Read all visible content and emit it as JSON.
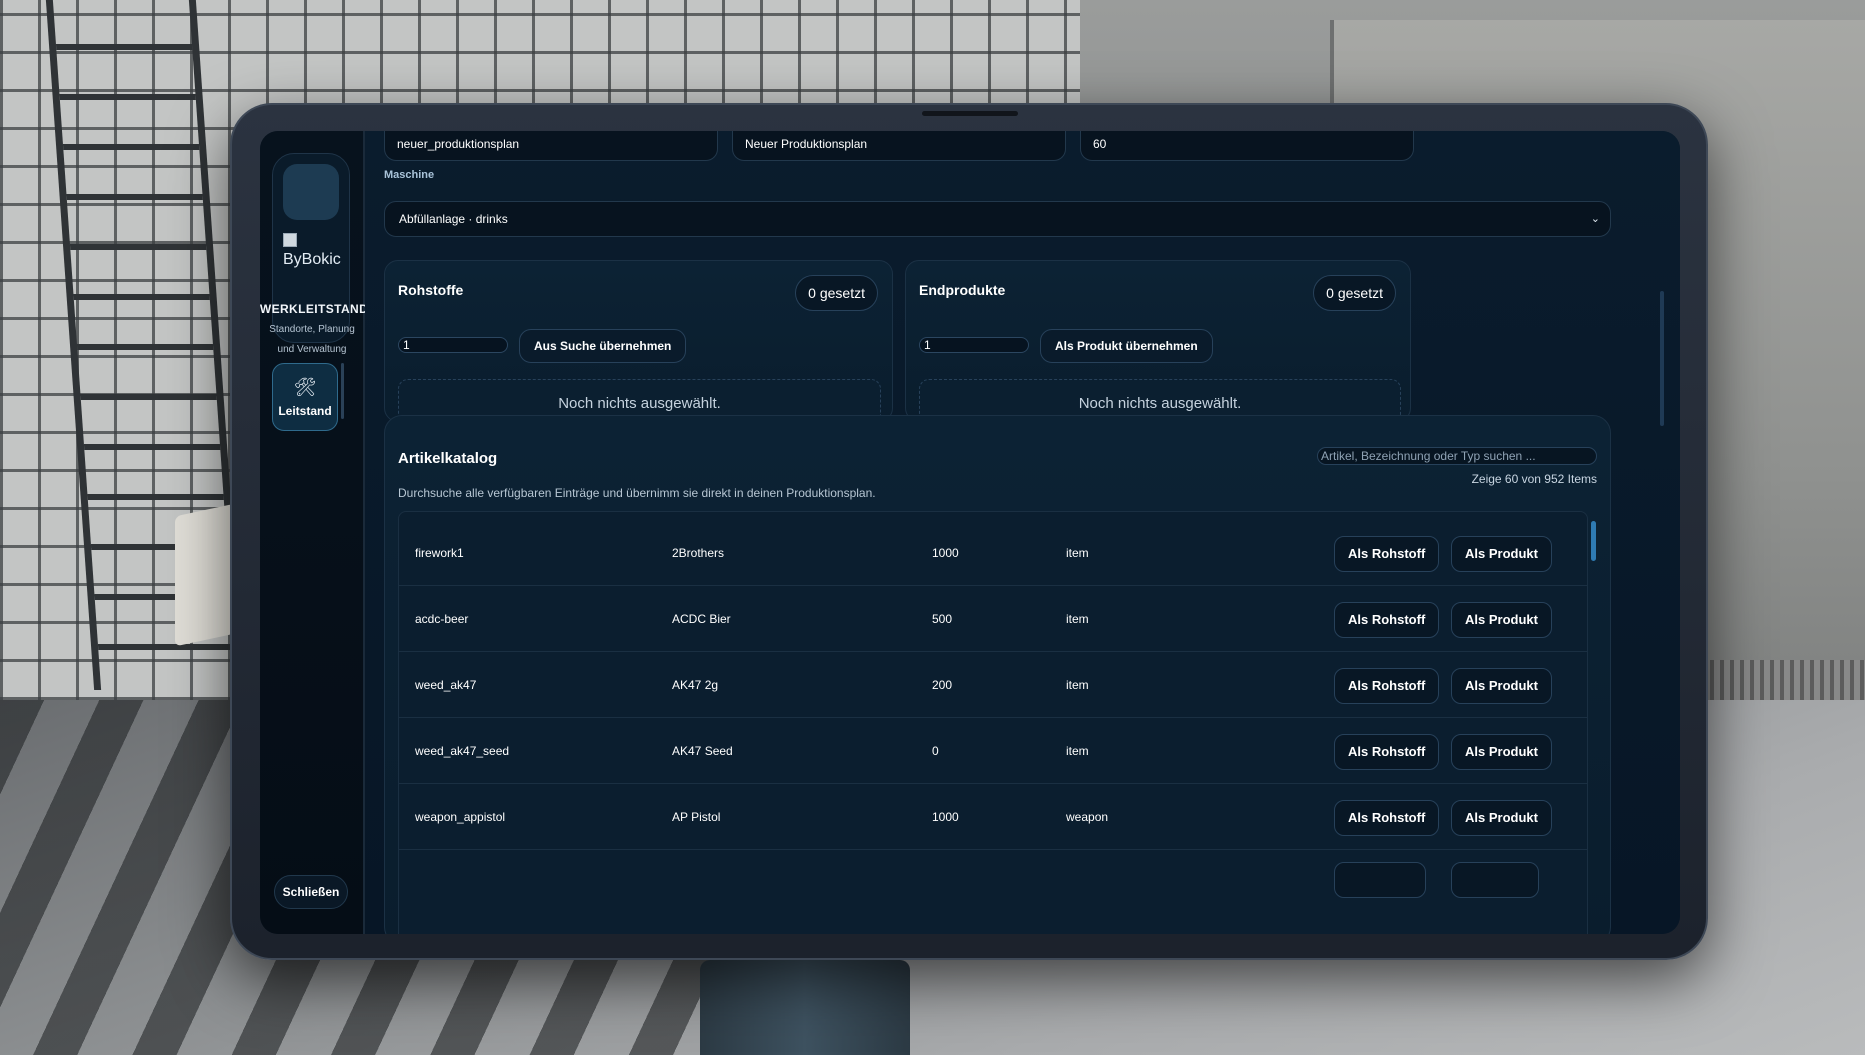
{
  "form": {
    "id_value": "neuer_produktionsplan",
    "name_value": "Neuer Produktionsplan",
    "time_value": "60",
    "machine_label": "Maschine",
    "machine_value": "Abfüllanlage · drinks",
    "chevron_icon": "chevron-down-icon"
  },
  "sidebar": {
    "brand_alt": "ByBokic",
    "title": "WERKLEITSTAND",
    "subtitle": "Standorte, Planung und Verwaltung",
    "nav": [
      {
        "label": "Leitstand",
        "icon": "tools-icon",
        "glyph": "🛠"
      }
    ],
    "close_label": "Schließen"
  },
  "rohstoffe": {
    "title": "Rohstoffe",
    "badge": "0 gesetzt",
    "qty": "1",
    "button": "Aus Suche übernehmen",
    "empty": "Noch nichts ausgewählt."
  },
  "endprodukte": {
    "title": "Endprodukte",
    "badge": "0 gesetzt",
    "qty": "1",
    "button": "Als Produkt übernehmen",
    "empty": "Noch nichts ausgewählt."
  },
  "catalog": {
    "title": "Artikelkatalog",
    "description": "Durchsuche alle verfügbaren Einträge und übernimm sie direkt in deinen Produktionsplan.",
    "search_placeholder": "Artikel, Bezeichnung oder Typ suchen ...",
    "count": "Zeige 60 von 952 Items",
    "raw_button": "Als Rohstoff",
    "product_button": "Als Produkt",
    "rows": [
      {
        "name": "firework1",
        "label": "2Brothers",
        "weight": "1000",
        "type": "item"
      },
      {
        "name": "acdc-beer",
        "label": "ACDC Bier",
        "weight": "500",
        "type": "item"
      },
      {
        "name": "weed_ak47",
        "label": "AK47 2g",
        "weight": "200",
        "type": "item"
      },
      {
        "name": "weed_ak47_seed",
        "label": "AK47 Seed",
        "weight": "0",
        "type": "item"
      },
      {
        "name": "weapon_appistol",
        "label": "AP Pistol",
        "weight": "1000",
        "type": "weapon"
      }
    ]
  }
}
